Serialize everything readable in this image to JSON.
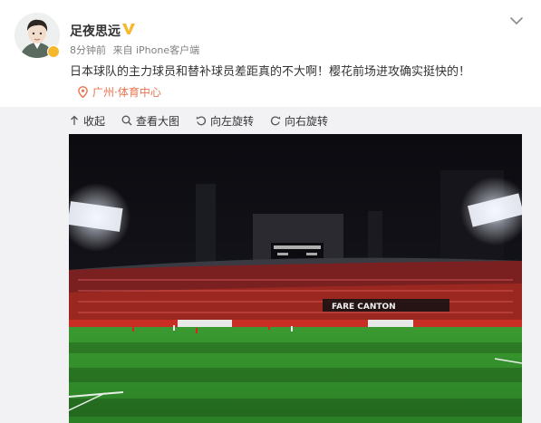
{
  "post": {
    "author": {
      "name": "足夜思远",
      "avatar_icon": "user-avatar-icon",
      "verified_icon": "vip-badge-icon"
    },
    "time": "8分钟前",
    "source": "来自 iPhone客户端",
    "text": "日本球队的主力球员和替补球员差距真的不大啊！樱花前场进攻确实挺快的！",
    "location": {
      "icon": "location-pin-icon",
      "label": "广州·体育中心"
    },
    "menu_icon": "chevron-down-icon"
  },
  "media_toolbar": {
    "collapse": "收起",
    "view_large": "查看大图",
    "rotate_left": "向左旋转",
    "rotate_right": "向右旋转"
  },
  "photo": {
    "scoreboard_text": "",
    "banner_text": "FARE CANTON"
  },
  "colors": {
    "accent_orange": "#eb7350",
    "badge_gold": "#f6b82c",
    "toolbar_bg": "#f2f2f5",
    "pitch_green": "#2f8b2a"
  }
}
